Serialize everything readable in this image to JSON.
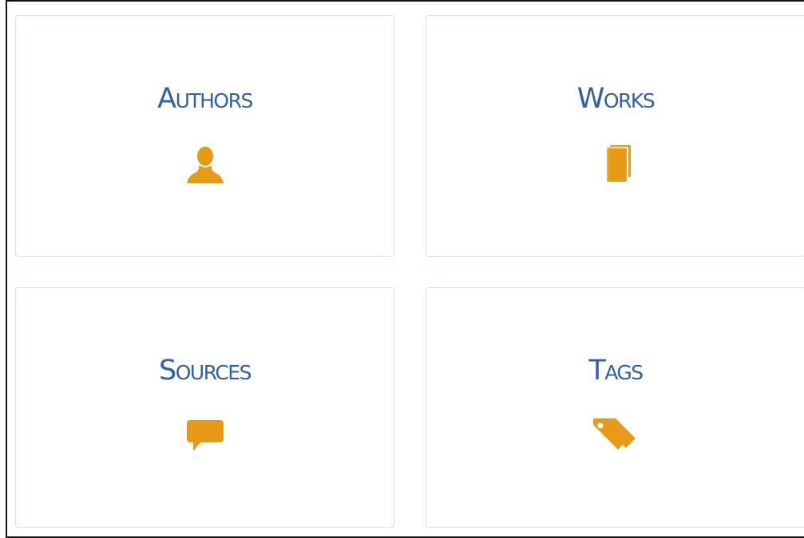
{
  "colors": {
    "label": "#2f62a3",
    "icon": "#e79a16",
    "tile_border": "#cfe6e4",
    "frame_border": "#111111"
  },
  "tiles": [
    {
      "label": "Authors",
      "icon": "person-icon"
    },
    {
      "label": "Works",
      "icon": "book-icon"
    },
    {
      "label": "Sources",
      "icon": "speech-bubble-icon"
    },
    {
      "label": "Tags",
      "icon": "tags-icon"
    }
  ]
}
